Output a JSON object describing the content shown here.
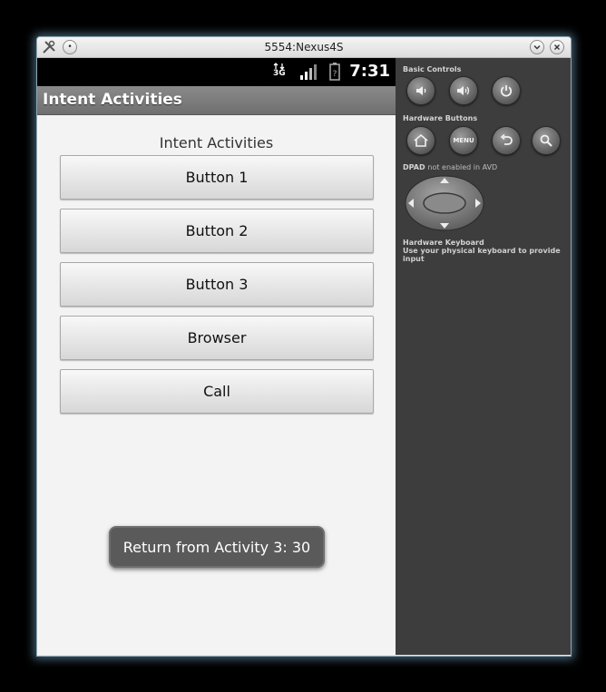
{
  "window": {
    "title": "5554:Nexus4S"
  },
  "status_bar": {
    "network": "3G",
    "time": "7:31"
  },
  "app": {
    "title": "Intent Activities",
    "content_title": "Intent Activities",
    "buttons": [
      {
        "label": "Button 1"
      },
      {
        "label": "Button 2"
      },
      {
        "label": "Button 3"
      },
      {
        "label": "Browser"
      },
      {
        "label": "Call"
      }
    ],
    "toast": "Return from Activity 3: 30"
  },
  "controls": {
    "basic_label": "Basic Controls",
    "hardware_label": "Hardware Buttons",
    "menu_label": "MENU",
    "dpad_title": "DPAD",
    "dpad_note": "not enabled in AVD",
    "keyboard_title": "Hardware Keyboard",
    "keyboard_note": "Use your physical keyboard to provide input"
  }
}
